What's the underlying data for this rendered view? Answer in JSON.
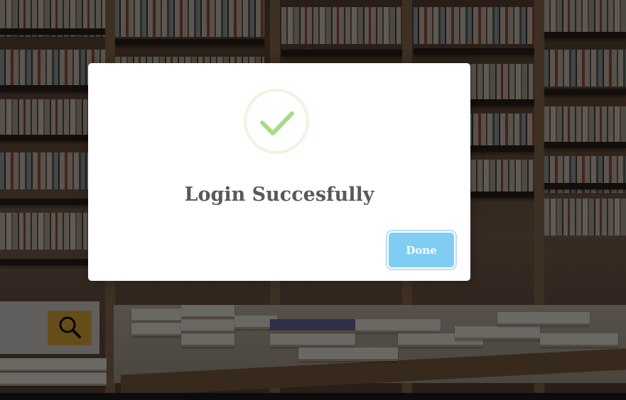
{
  "modal": {
    "title": "Login Succesfully",
    "icon": "success-checkmark-icon",
    "done_label": "Done",
    "accent_color": "#a5dc86",
    "button_color": "#80cdf3"
  },
  "search": {
    "icon": "search-icon",
    "button_color": "#e1aa3a"
  },
  "background": {
    "description_icon": "bookstore-background-image"
  }
}
